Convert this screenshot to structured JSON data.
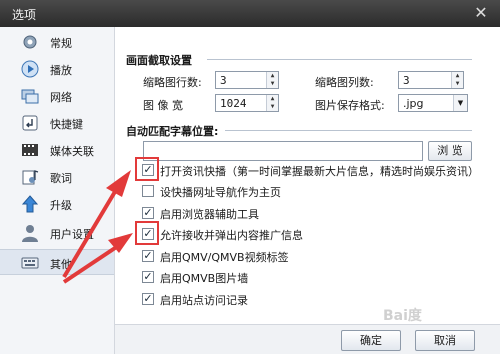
{
  "window": {
    "title": "选项",
    "close_icon": "close-icon"
  },
  "sidebar": {
    "items": [
      {
        "label": "常规",
        "icon": "gear-icon"
      },
      {
        "label": "播放",
        "icon": "play-icon"
      },
      {
        "label": "网络",
        "icon": "network-icon"
      },
      {
        "label": "快捷键",
        "icon": "shortcut-icon"
      },
      {
        "label": "媒体关联",
        "icon": "film-icon"
      },
      {
        "label": "歌词",
        "icon": "lyrics-icon"
      },
      {
        "label": "升级",
        "icon": "upgrade-icon"
      },
      {
        "label": "用户设置",
        "icon": "user-icon"
      },
      {
        "label": "其他",
        "icon": "other-icon",
        "selected": true
      }
    ]
  },
  "screenshot": {
    "title": "画面截取设置",
    "rows_label": "缩略图行数:",
    "rows_value": "3",
    "cols_label": "缩略图列数:",
    "cols_value": "3",
    "width_label": "图 像 宽",
    "width_value": "1024",
    "format_label": "图片保存格式:",
    "format_value": ".jpg"
  },
  "subtitle": {
    "title": "自动匹配字幕位置:",
    "path_value": "",
    "browse_label": "浏 览"
  },
  "options": [
    {
      "label": "打开资讯快播（第一时间掌握最新大片信息，精选时尚娱乐资讯）",
      "checked": true
    },
    {
      "label": "设快播网址导航作为主页",
      "checked": false
    },
    {
      "label": "启用浏览器辅助工具",
      "checked": true
    },
    {
      "label": "允许接收并弹出内容推广信息",
      "checked": true
    },
    {
      "label": "启用QMV/QMVB视频标签",
      "checked": true
    },
    {
      "label": "启用QMVB图片墙",
      "checked": true
    },
    {
      "label": "启用站点访问记录",
      "checked": true
    }
  ],
  "footer": {
    "ok_label": "确定",
    "cancel_label": "取消"
  },
  "watermark": "Bai度",
  "colors": {
    "annotation": "#e23a3a",
    "selected_bg": "#dfe6f0"
  }
}
